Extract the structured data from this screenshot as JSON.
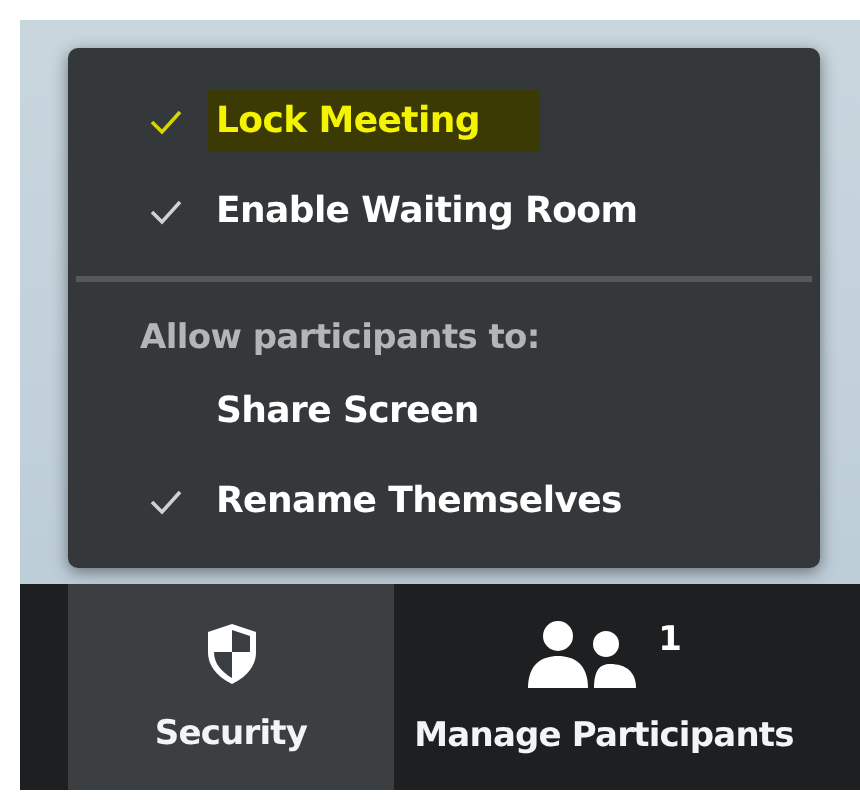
{
  "menu": {
    "items": [
      {
        "label": "Lock Meeting",
        "checked": true,
        "highlighted": true
      },
      {
        "label": "Enable Waiting Room",
        "checked": true,
        "highlighted": false
      }
    ],
    "section": {
      "heading": "Allow participants to:",
      "items": [
        {
          "label": "Share Screen",
          "checked": false,
          "highlighted": false
        },
        {
          "label": "Rename Themselves",
          "checked": true,
          "highlighted": false
        }
      ]
    }
  },
  "toolbar": {
    "buttons": [
      {
        "kind": "security",
        "label": "Security",
        "selected": true
      },
      {
        "kind": "participants",
        "label": "Manage Participants",
        "count": "1",
        "selected": false
      }
    ]
  }
}
